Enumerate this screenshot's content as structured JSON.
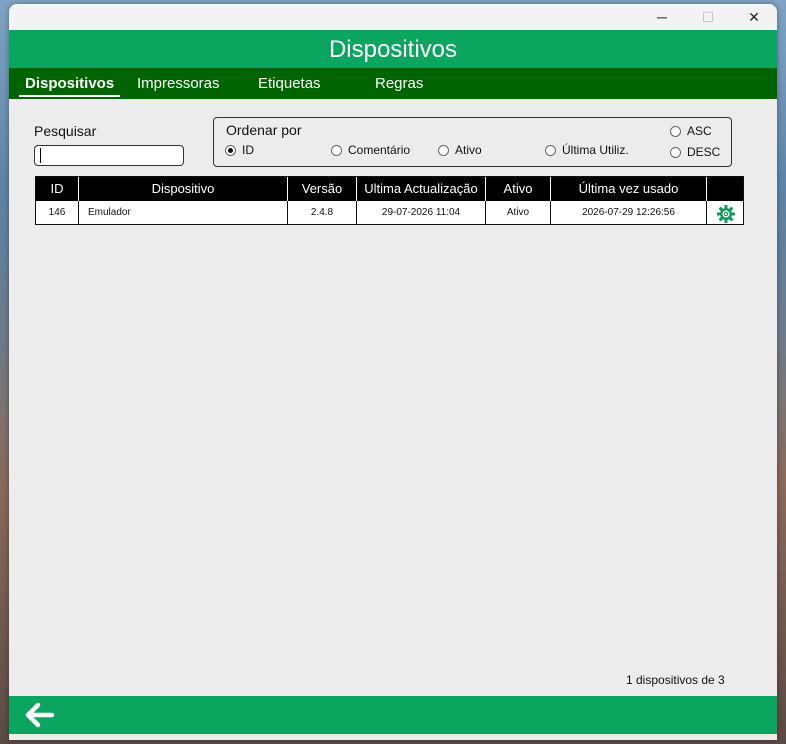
{
  "window": {
    "controls": {
      "minimize": "─",
      "maximize": "☐",
      "close": "✕"
    }
  },
  "header": {
    "title": "Dispositivos"
  },
  "tabs": [
    {
      "label": "Dispositivos",
      "active": true
    },
    {
      "label": "Impressoras",
      "active": false
    },
    {
      "label": "Etiquetas",
      "active": false
    },
    {
      "label": "Regras",
      "active": false
    }
  ],
  "search": {
    "label": "Pesquisar",
    "value": ""
  },
  "sort": {
    "title": "Ordenar por",
    "options": [
      {
        "label": "ID",
        "checked": true
      },
      {
        "label": "Comentário",
        "checked": false
      },
      {
        "label": "Ativo",
        "checked": false
      },
      {
        "label": "Última Utiliz.",
        "checked": false
      }
    ],
    "direction": [
      {
        "label": "ASC",
        "checked": false
      },
      {
        "label": "DESC",
        "checked": false
      }
    ]
  },
  "table": {
    "columns": [
      "ID",
      "Dispositivo",
      "Versão",
      "Ultima Actualização",
      "Ativo",
      "Última vez usado",
      ""
    ],
    "rows": [
      {
        "id": "146",
        "device": "Emulador",
        "version": "2.4.8",
        "updated": "29-07-2026 11:04",
        "active": "Ativo",
        "last_used": "2026-07-29 12:26:56",
        "action_icon": "gear-icon"
      }
    ]
  },
  "footer": {
    "count": "1 dispositivos de 3",
    "back_icon": "arrow-left-icon"
  },
  "colors": {
    "primary": "#0aa55f",
    "dark": "#006400",
    "gear": "#0a9a55"
  }
}
